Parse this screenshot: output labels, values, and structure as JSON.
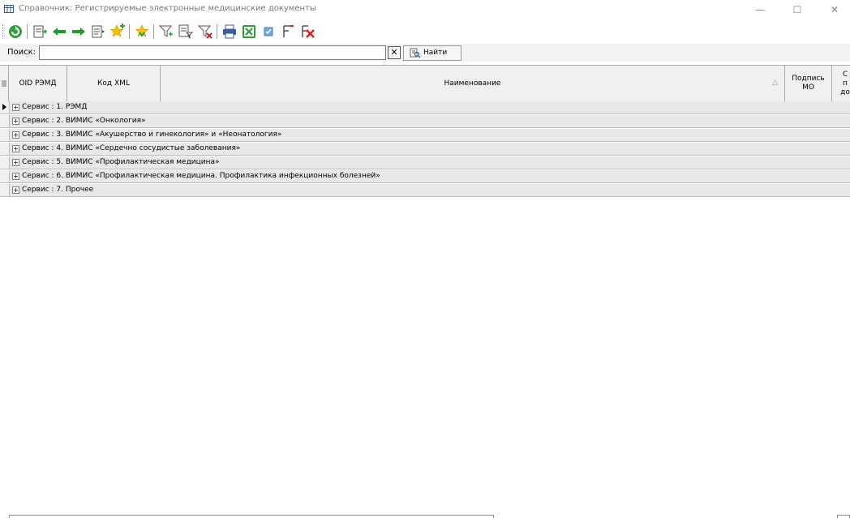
{
  "window": {
    "title": "Справочник: Регистрируемые электронные медицинские документы",
    "icon": "table-grid-icon",
    "minimize_glyph": "—",
    "maximize_glyph": "☐",
    "close_glyph": "✕"
  },
  "toolbar": {
    "buttons": [
      "refresh-icon",
      "open-record-icon",
      "back-arrow-icon",
      "forward-arrow-icon",
      "view-record-icon",
      "add-favorite-icon",
      "favorites-icon",
      "filter-icon",
      "edit-filter-icon",
      "clear-filter-icon",
      "print-icon",
      "excel-export-icon",
      "checkbox-icon",
      "column-settings-icon",
      "delete-icon"
    ]
  },
  "search": {
    "label": "Поиск:",
    "value": "",
    "clear_glyph": "✕",
    "find_label": "Найти"
  },
  "grid": {
    "columns": {
      "oid": "OID РЭМД",
      "xml": "Код XML",
      "name": "Наименование",
      "sign": "Подпись МО",
      "extra": "С п до"
    },
    "sort_glyph": "△",
    "groups": [
      "Сервис : 1. РЭМД",
      "Сервис : 2. ВИМИС «Онкология»",
      "Сервис : 3. ВИМИС «Акушерство и гинекология» и «Неонатология»",
      "Сервис : 4. ВИМИС «Сердечно сосудистые заболевания»",
      "Сервис : 5. ВИМИС «Профилактическая медицина»",
      "Сервис : 6. ВИМИС «Профилактическая медицина. Профилактика инфекционных болезней»",
      "Сервис : 7. Прочее"
    ],
    "expand_glyph": "+"
  },
  "colors": {
    "accent_green": "#2e9e3a",
    "arrow_green": "#1f9c2a",
    "star_yellow": "#f2c200",
    "delete_red": "#d42020",
    "group_row_bg": "#e8e8e8"
  }
}
